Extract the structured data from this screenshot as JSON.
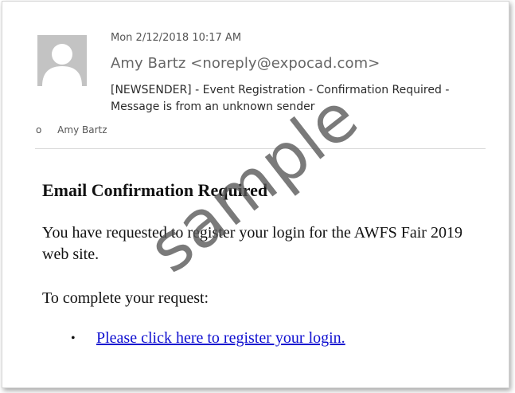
{
  "header": {
    "date": "Mon 2/12/2018 10:17 AM",
    "from": "Amy Bartz <noreply@expocad.com>",
    "subject": "[NEWSENDER] - Event Registration - Confirmation Required - Message is from an unknown sender",
    "to_prefix": "o",
    "to": "Amy Bartz"
  },
  "body": {
    "heading": "Email Confirmation Required",
    "intro": "You have requested to register your login for the AWFS Fair 2019 web site.",
    "complete": "To complete your request:",
    "bullet": "•",
    "link_text": "Please click here to register your login."
  },
  "watermark": "sample",
  "icons": {
    "avatar": "person-placeholder-icon"
  },
  "colors": {
    "link": "#1010d0",
    "avatar_bg": "#c3c3c3"
  }
}
